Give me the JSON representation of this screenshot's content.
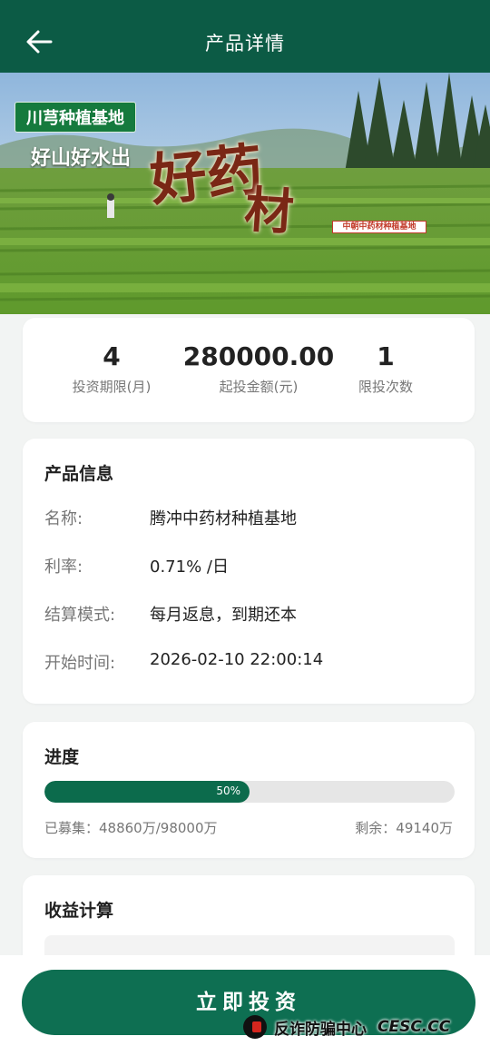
{
  "header": {
    "title": "产品详情",
    "back_icon": "back-arrow-icon"
  },
  "banner": {
    "tag": "川芎种植基地",
    "subtitle": "好山好水出",
    "big_a": "好药",
    "big_b": "材",
    "sign": "中朝中药材种植基地"
  },
  "stats": [
    {
      "value": "4",
      "label": "投资期限(月)"
    },
    {
      "value": "280000.00",
      "label": "起投金额(元)"
    },
    {
      "value": "1",
      "label": "限投次数"
    }
  ],
  "product_info": {
    "title": "产品信息",
    "rows": [
      {
        "key": "名称:",
        "value": "腾冲中药材种植基地"
      },
      {
        "key": "利率:",
        "value": "0.71% /日"
      },
      {
        "key": "结算模式:",
        "value": "每月返息，到期还本"
      },
      {
        "key": "开始时间:",
        "value": "2026-02-10 22:00:14"
      }
    ]
  },
  "progress": {
    "title": "进度",
    "percent_text": "50%",
    "percent": 0.5,
    "raised": "已募集：48860万/98000万",
    "remaining": "剩余：49140万"
  },
  "income": {
    "title": "收益计算"
  },
  "action": {
    "invest_label": "立即投资"
  },
  "watermark": {
    "text": "反诈防骗中心",
    "site": "CESC.CC"
  },
  "colors": {
    "primary": "#0c5b45",
    "button": "#0e6f52",
    "bar": "#0c6b4c"
  }
}
